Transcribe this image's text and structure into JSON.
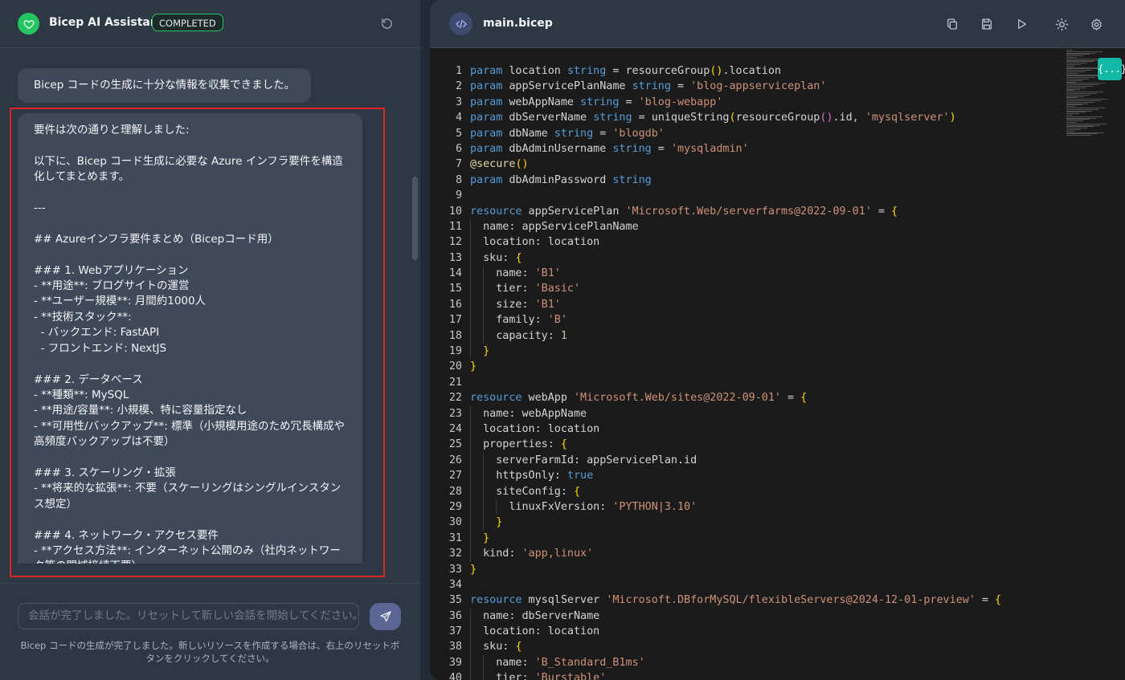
{
  "app": {
    "title": "Bicep AI Assistant",
    "status": "COMPLETED"
  },
  "chat": {
    "message1": "Bicep コードの生成に十分な情報を収集できました。",
    "message2_lines": [
      "要件は次の通りと理解しました:",
      "",
      "以下に、Bicep コード生成に必要な Azure インフラ要件を構造",
      "化してまとめます。",
      "",
      "---",
      "",
      "## Azureインフラ要件まとめ（Bicepコード用）",
      "",
      "### 1. Webアプリケーション",
      "- **用途**: ブログサイトの運営",
      "- **ユーザー規模**: 月間約1000人",
      "- **技術スタック**:",
      "  - バックエンド: FastAPI",
      "  - フロントエンド: NextJS",
      "",
      "### 2. データベース",
      "- **種類**: MySQL",
      "- **用途/容量**: 小規模、特に容量指定なし",
      "- **可用性/バックアップ**: 標準（小規模用途のため冗長構成や",
      "高頻度バックアップは不要）",
      "",
      "### 3. スケーリング・拡張",
      "- **将来的な拡張**: 不要（スケーリングはシングルインスタン",
      "ス想定）",
      "",
      "### 4. ネットワーク・アクセス要件",
      "- **アクセス方法**: インターネット公開のみ（社内ネットワー",
      "ク等の閉域接続不要）"
    ]
  },
  "input": {
    "placeholder": "会話が完了しました。リセットして新しい会話を開始してください。",
    "footnote": "Bicep コードの生成が完了しました。新しいリソースを作成する場合は、右上のリセットボタンをクリックしてください。"
  },
  "editor": {
    "filename": "main.bicep",
    "braces_label": "{...}",
    "toolbar": [
      "copy-icon",
      "save-icon",
      "play-icon",
      "sun-icon",
      "gear-icon"
    ],
    "code_lines": [
      "param location string = resourceGroup().location",
      "param appServicePlanName string = 'blog-appserviceplan'",
      "param webAppName string = 'blog-webapp'",
      "param dbServerName string = uniqueString(resourceGroup().id, 'mysqlserver')",
      "param dbName string = 'blogdb'",
      "param dbAdminUsername string = 'mysqladmin'",
      "@secure()",
      "param dbAdminPassword string",
      "",
      "resource appServicePlan 'Microsoft.Web/serverfarms@2022-09-01' = {",
      "  name: appServicePlanName",
      "  location: location",
      "  sku: {",
      "    name: 'B1'",
      "    tier: 'Basic'",
      "    size: 'B1'",
      "    family: 'B'",
      "    capacity: 1",
      "  }",
      "}",
      "",
      "resource webApp 'Microsoft.Web/sites@2022-09-01' = {",
      "  name: webAppName",
      "  location: location",
      "  properties: {",
      "    serverFarmId: appServicePlan.id",
      "    httpsOnly: true",
      "    siteConfig: {",
      "      linuxFxVersion: 'PYTHON|3.10'",
      "    }",
      "  }",
      "  kind: 'app,linux'",
      "}",
      "",
      "resource mysqlServer 'Microsoft.DBforMySQL/flexibleServers@2024-12-01-preview' = {",
      "  name: dbServerName",
      "  location: location",
      "  sku: {",
      "    name: 'B_Standard_B1ms'",
      "    tier: 'Burstable'"
    ]
  }
}
